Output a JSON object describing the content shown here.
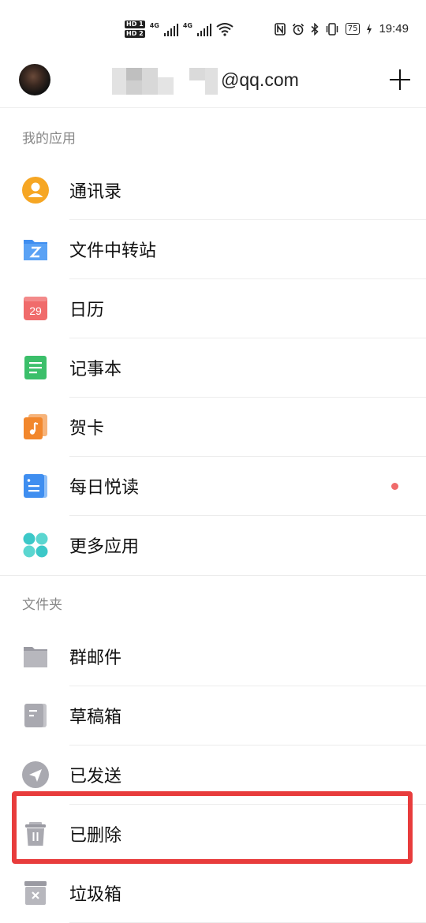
{
  "status_bar": {
    "hd1": "HD 1",
    "hd2": "HD 2",
    "net1": "4G",
    "net2": "4G",
    "battery": "75",
    "time": "19:49"
  },
  "header": {
    "email_suffix": "@qq.com",
    "add_icon": "plus-icon"
  },
  "sections": {
    "apps_title": "我的应用",
    "folders_title": "文件夹"
  },
  "apps": [
    {
      "label": "通讯录",
      "icon": "contacts-icon",
      "color": "#f6a623"
    },
    {
      "label": "文件中转站",
      "icon": "file-transfer-icon",
      "color": "#3f8ef0"
    },
    {
      "label": "日历",
      "icon": "calendar-icon",
      "color": "#f06b6b",
      "icon_text": "29"
    },
    {
      "label": "记事本",
      "icon": "notepad-icon",
      "color": "#3bbf6a"
    },
    {
      "label": "贺卡",
      "icon": "greeting-card-icon",
      "color": "#f2872c"
    },
    {
      "label": "每日悦读",
      "icon": "daily-read-icon",
      "color": "#3f8ef0",
      "badge": true
    },
    {
      "label": "更多应用",
      "icon": "more-apps-icon",
      "color": "#3cc8c8"
    }
  ],
  "folders": [
    {
      "label": "群邮件",
      "icon": "folder-icon"
    },
    {
      "label": "草稿箱",
      "icon": "drafts-icon"
    },
    {
      "label": "已发送",
      "icon": "sent-icon"
    },
    {
      "label": "已删除",
      "icon": "trash-icon"
    },
    {
      "label": "垃圾箱",
      "icon": "spam-icon"
    }
  ]
}
